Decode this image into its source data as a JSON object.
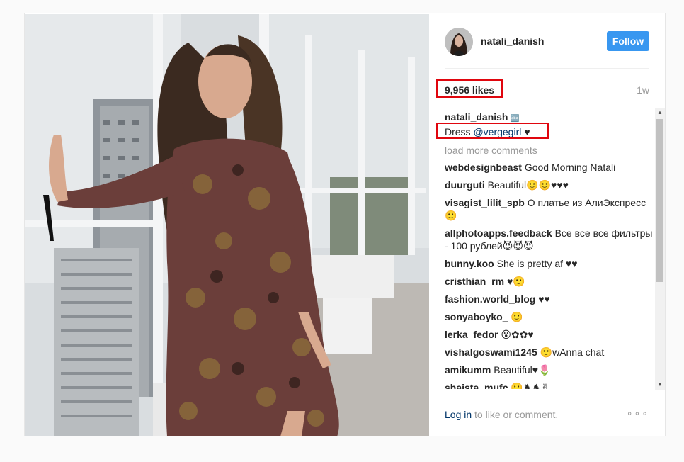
{
  "post": {
    "username": "natali_danish",
    "follow_label": "Follow",
    "likes": "9,956 likes",
    "time": "1w",
    "caption_user": "natali_danish",
    "caption_badge": "🔤",
    "caption_prefix": "Dress ",
    "caption_mention": "@vergegirl",
    "caption_suffix": " ♥",
    "load_more": "load more comments",
    "login_link": "Log in",
    "login_rest": " to like or comment.",
    "more_dots": "∘∘∘"
  },
  "comments": [
    {
      "user": "webdesignbeast",
      "text": "Good Morning Natali"
    },
    {
      "user": "duurguti",
      "text": "Beautiful🙂🙂♥♥♥"
    },
    {
      "user": "visagist_lilit_spb",
      "text": "О платье из АлиЭкспресс 🙂"
    },
    {
      "user": "allphotoapps.feedback",
      "text": "Все все все фильтры - 100 рублей😈😈😈"
    },
    {
      "user": "bunny.koo",
      "text": "She is pretty af ♥♥"
    },
    {
      "user": "cristhian_rm",
      "text": "♥🙂"
    },
    {
      "user": "fashion.world_blog",
      "text": "♥♥"
    },
    {
      "user": "sonyaboyko_",
      "text": "🙂"
    },
    {
      "user": "lerka_fedor",
      "text": "😮✿✿♥"
    },
    {
      "user": "vishalgoswami1245",
      "text": "🙂wAnna chat"
    },
    {
      "user": "amikumm",
      "text": "Beautiful♥🌷"
    },
    {
      "user": "shaista_mufc",
      "text": "🙂♞♞✌"
    }
  ],
  "colors": {
    "follow_bg": "#3897f0",
    "highlight_border": "#e0060e",
    "link": "#003569",
    "muted": "#999999"
  }
}
